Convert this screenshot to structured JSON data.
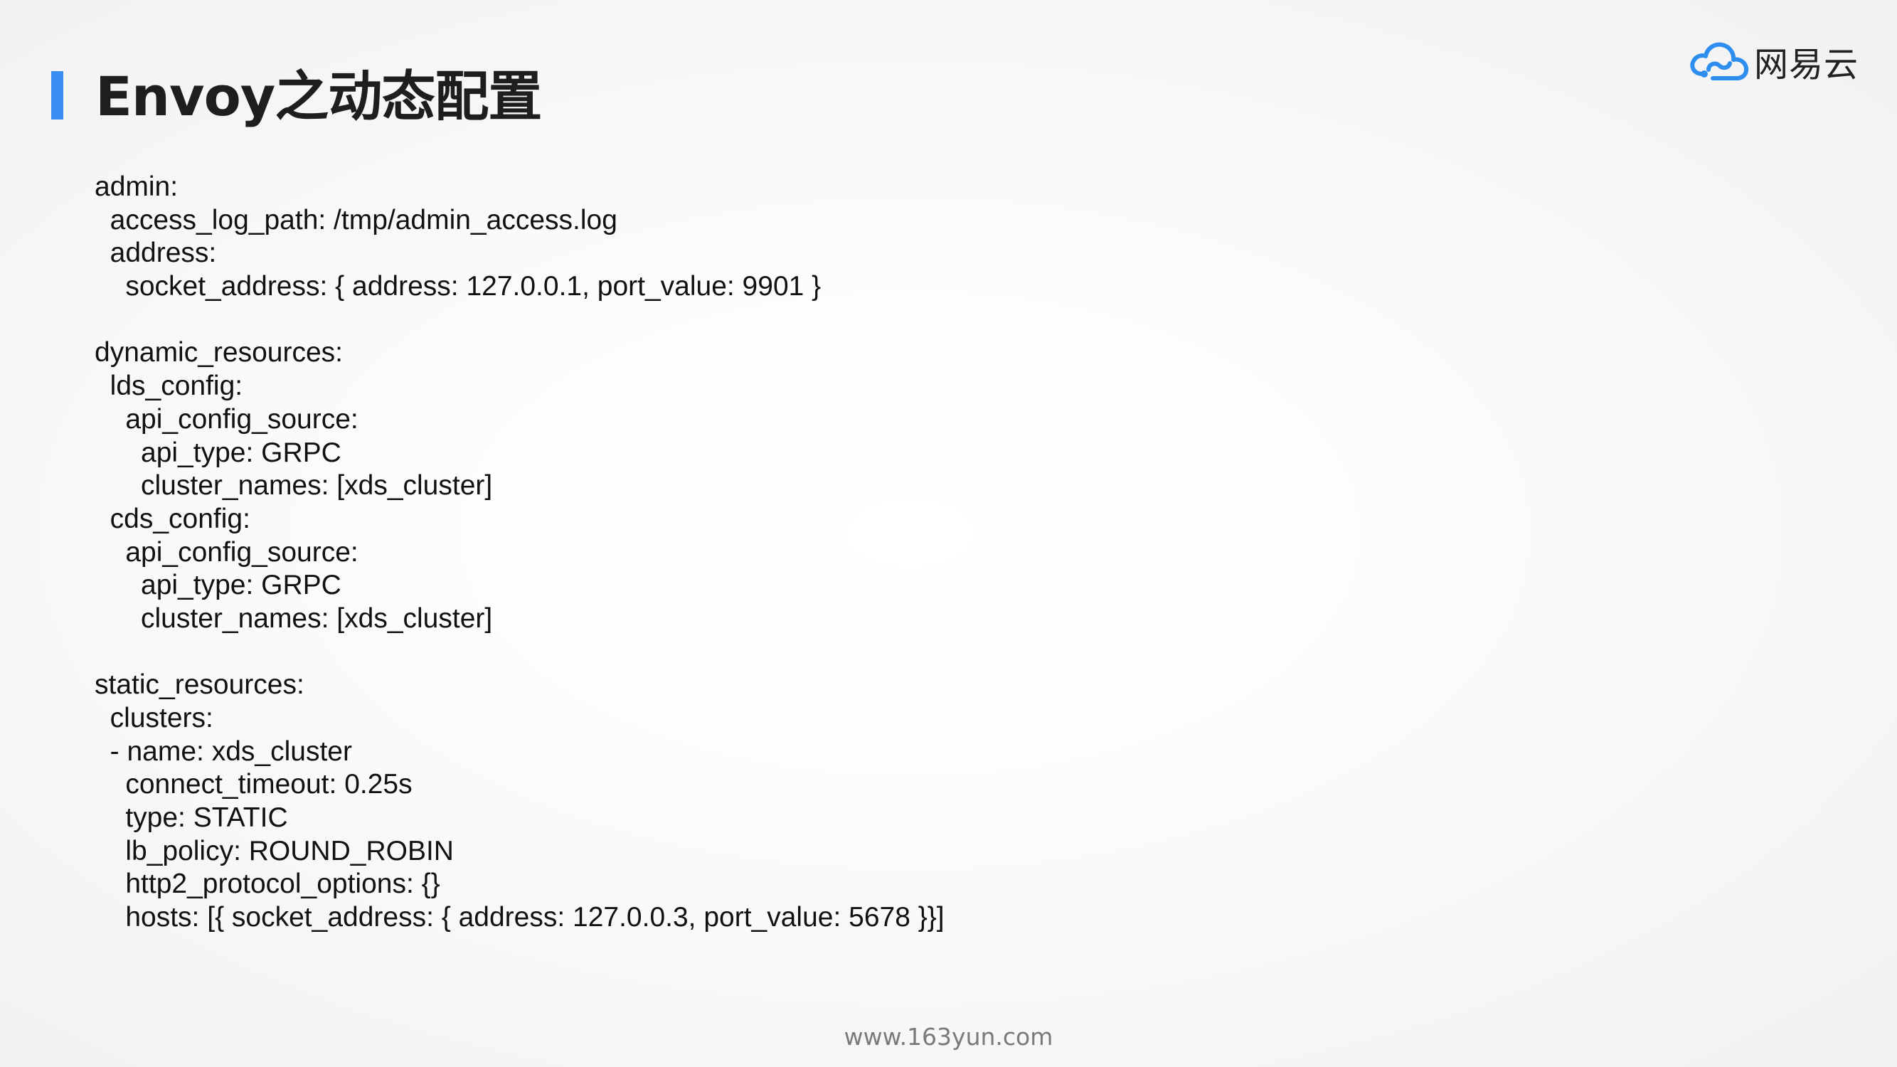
{
  "slide": {
    "title": "Envoy之动态配置",
    "accent_color": "#3a8ff2",
    "footer_url": "www.163yun.com"
  },
  "logo": {
    "icon": "netease-cloud-icon",
    "text": "网易云",
    "icon_color": "#2e8ef0"
  },
  "code": {
    "lines": [
      "admin:",
      "  access_log_path: /tmp/admin_access.log",
      "  address:",
      "    socket_address: { address: 127.0.0.1, port_value: 9901 }",
      "",
      "dynamic_resources:",
      "  lds_config:",
      "    api_config_source:",
      "      api_type: GRPC",
      "      cluster_names: [xds_cluster]",
      "  cds_config:",
      "    api_config_source:",
      "      api_type: GRPC",
      "      cluster_names: [xds_cluster]",
      "",
      "static_resources:",
      "  clusters:",
      "  - name: xds_cluster",
      "    connect_timeout: 0.25s",
      "    type: STATIC",
      "    lb_policy: ROUND_ROBIN",
      "    http2_protocol_options: {}",
      "    hosts: [{ socket_address: { address: 127.0.0.3, port_value: 5678 }}]"
    ]
  }
}
